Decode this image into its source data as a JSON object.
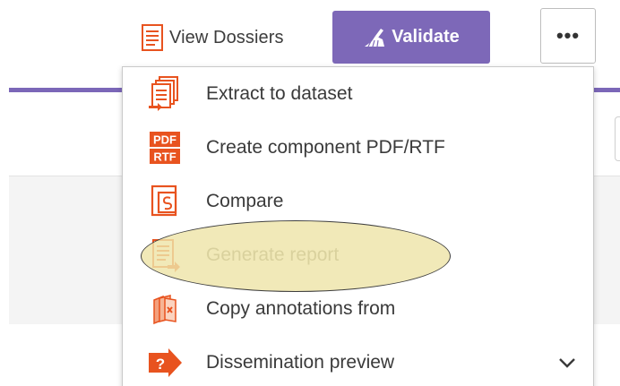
{
  "toolbar": {
    "view_dossiers_label": "View Dossiers",
    "validate_label": "Validate",
    "more_label": "•••"
  },
  "menu": {
    "items": [
      {
        "label": "Extract to dataset",
        "icon": "extract-documents-icon"
      },
      {
        "label": "Create component PDF/RTF",
        "icon": "pdf-rtf-icon"
      },
      {
        "label": "Compare",
        "icon": "compare-icon"
      },
      {
        "label": "Generate report",
        "icon": "generate-report-icon",
        "highlighted": true
      },
      {
        "label": "Copy annotations from",
        "icon": "copy-annotations-icon"
      },
      {
        "label": "Dissemination preview",
        "icon": "dissemination-preview-icon",
        "has_expand": true
      }
    ],
    "pdf_icon_text": "PDF",
    "rtf_icon_text": "RTF",
    "dissemination_icon_text": "?"
  },
  "colors": {
    "accent_purple": "#7d68b8",
    "icon_orange": "#e8531f",
    "highlight_fill": "#eee4a8"
  }
}
